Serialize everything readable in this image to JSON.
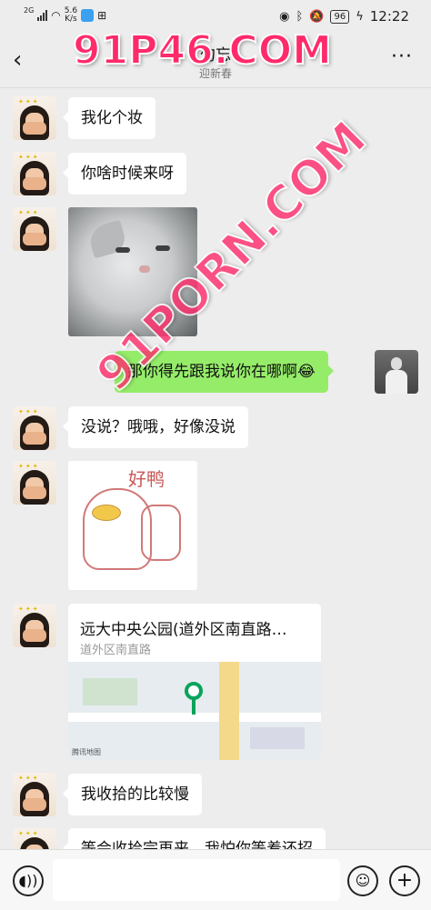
{
  "status_bar": {
    "network_type": "2G",
    "net_speed_value": "5.6",
    "net_speed_unit": "K/s",
    "battery": "96",
    "time": "12:22"
  },
  "header": {
    "title": "勿忘",
    "subtitle": "迎新春"
  },
  "messages": [
    {
      "side": "left",
      "type": "text",
      "text": "我化个妆"
    },
    {
      "side": "left",
      "type": "text",
      "text": "你啥时候来呀"
    },
    {
      "side": "left",
      "type": "image",
      "content": "cat-photo"
    },
    {
      "side": "right",
      "type": "text",
      "text": "那你得先跟我说你在哪啊😂"
    },
    {
      "side": "left",
      "type": "text",
      "text": "没说？哦哦，好像没说"
    },
    {
      "side": "left",
      "type": "sticker",
      "text": "好鸭"
    },
    {
      "side": "left",
      "type": "location",
      "title": "远大中央公园(道外区南直路…",
      "subtitle": "道外区南直路",
      "map_credit": "腾讯地图"
    },
    {
      "side": "left",
      "type": "text",
      "text": "我收拾的比较慢"
    },
    {
      "side": "left",
      "type": "text",
      "text": "等会收拾完再来，我怕你等着还招"
    }
  ],
  "input_bar": {
    "placeholder": ""
  },
  "watermark": {
    "top": "91P46.COM",
    "diagonal": "91PORN.COM"
  },
  "colors": {
    "background": "#ededed",
    "my_bubble": "#95ec69",
    "their_bubble": "#ffffff",
    "location_pin": "#07a35a",
    "watermark": "#ff2a6a"
  }
}
